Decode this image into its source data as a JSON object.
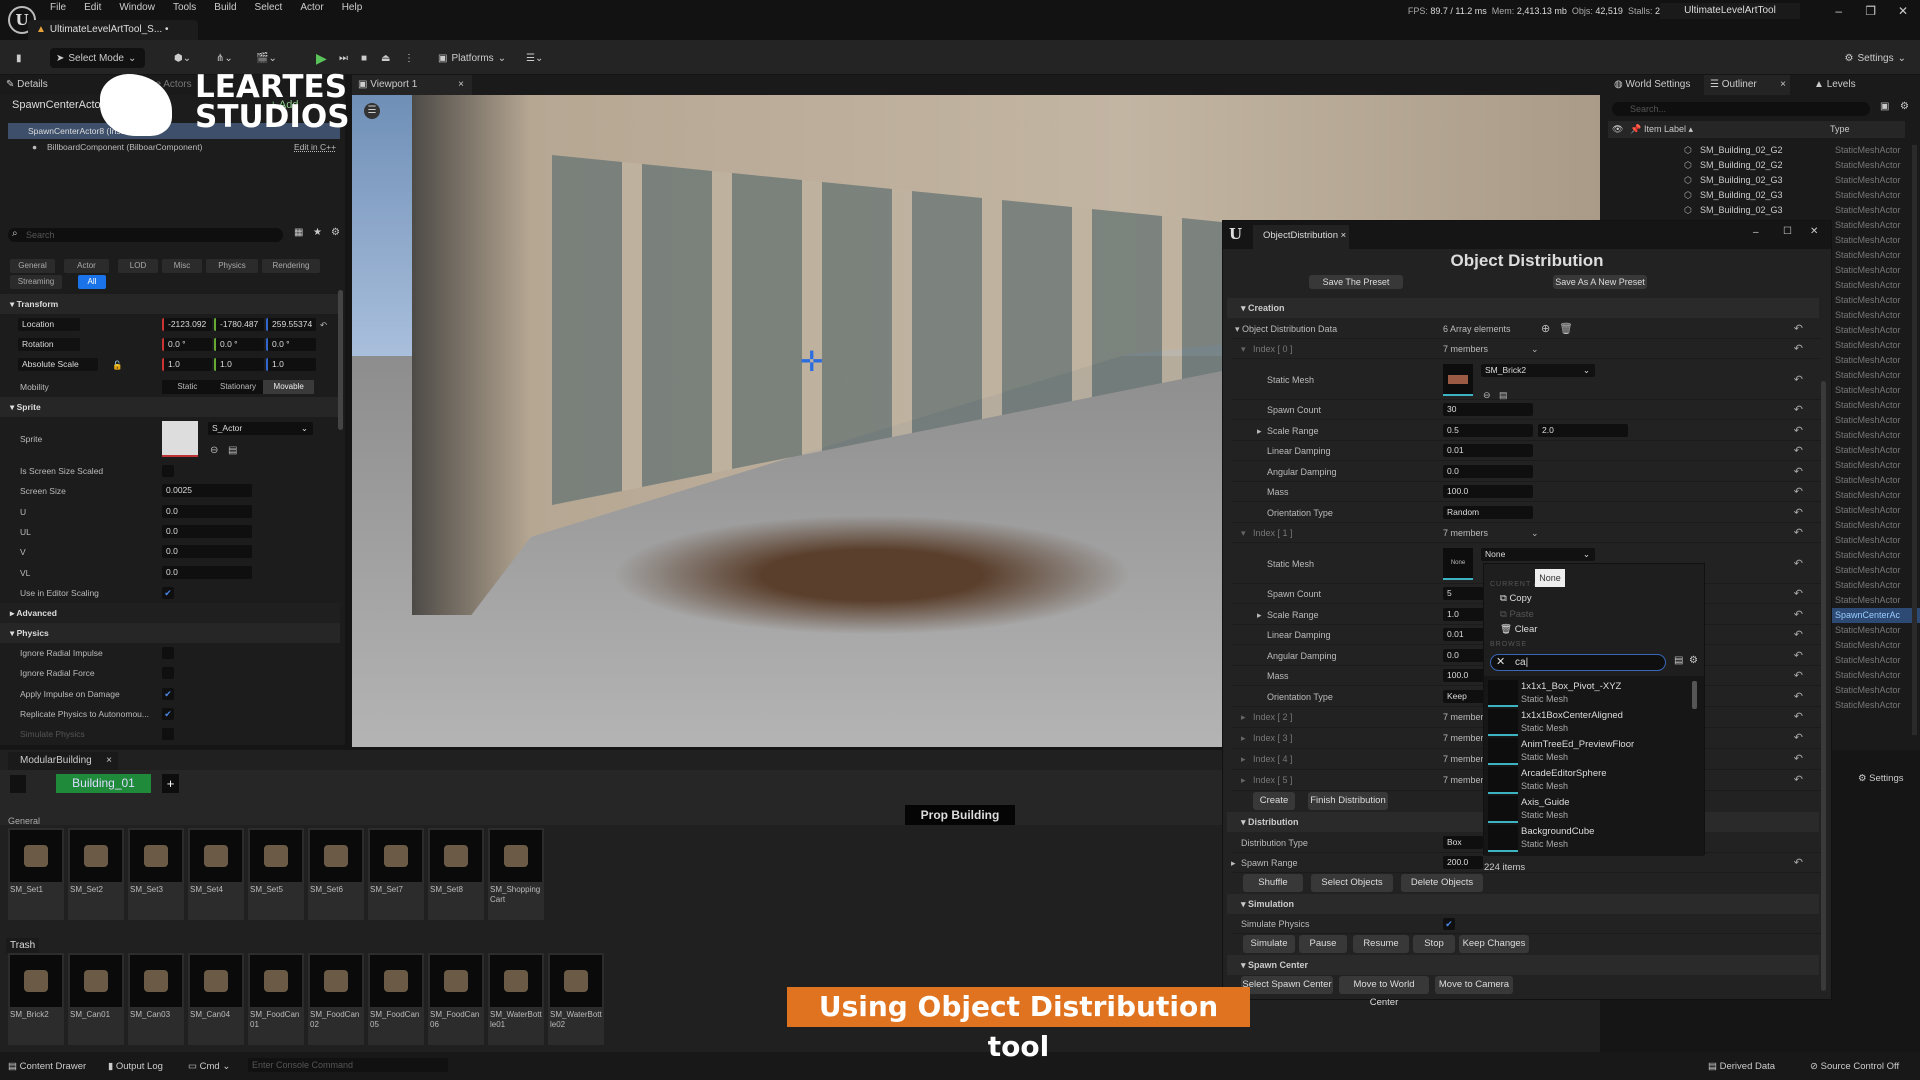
{
  "menu": [
    "File",
    "Edit",
    "Window",
    "Tools",
    "Build",
    "Select",
    "Actor",
    "Help"
  ],
  "doc_tab": "UltimateLevelArtTool_S...",
  "stats": {
    "fps_label": "FPS:",
    "fps": "89.7",
    "ms": "/ 11.2 ms",
    "mem_label": "Mem:",
    "mem": "2,413.13 mb",
    "objs_label": "Objs:",
    "objs": "42,519",
    "stalls_label": "Stalls:",
    "stalls": "2"
  },
  "app_title": "UltimateLevelArtTool",
  "toolbar": {
    "select_mode": "Select Mode",
    "platforms": "Platforms",
    "settings": "Settings"
  },
  "brand": {
    "line1": "LEARTES",
    "line2": "STUDIOS"
  },
  "details": {
    "tab": "Details",
    "tab2": "Place Actors",
    "actor": "SpawnCenterActor8",
    "add": "+ Add",
    "instance": "SpawnCenterActor8 (Instance)",
    "component": "BillboardComponent (BilboarComponent)",
    "edit_cpp": "Edit in C++",
    "search_placeholder": "Search",
    "categories": [
      "General",
      "Actor",
      "LOD",
      "Misc",
      "Physics",
      "Rendering",
      "Streaming",
      "All"
    ],
    "transform": "Transform",
    "location": {
      "label": "Location",
      "x": "-2123.092",
      "y": "-1780.487",
      "z": "259.55374"
    },
    "rotation": {
      "label": "Rotation",
      "x": "0.0 °",
      "y": "0.0 °",
      "z": "0.0 °"
    },
    "scale": {
      "label": "Absolute Scale",
      "x": "1.0",
      "y": "1.0",
      "z": "1.0"
    },
    "mobility": {
      "label": "Mobility",
      "options": [
        "Static",
        "Stationary",
        "Movable"
      ],
      "selected": "Movable"
    },
    "sprite_sec": "Sprite",
    "sprite_label": "Sprite",
    "sprite_value": "S_Actor",
    "sprite_rows": [
      {
        "label": "Is Screen Size Scaled",
        "type": "check",
        "checked": false
      },
      {
        "label": "Screen Size",
        "type": "field",
        "value": "0.0025"
      },
      {
        "label": "U",
        "type": "field",
        "value": "0.0"
      },
      {
        "label": "UL",
        "type": "field",
        "value": "0.0"
      },
      {
        "label": "V",
        "type": "field",
        "value": "0.0"
      },
      {
        "label": "VL",
        "type": "field",
        "value": "0.0"
      },
      {
        "label": "Use in Editor Scaling",
        "type": "check",
        "checked": true
      }
    ],
    "advanced": "Advanced",
    "physics": "Physics",
    "physics_rows": [
      {
        "label": "Ignore Radial Impulse",
        "checked": false
      },
      {
        "label": "Ignore Radial Force",
        "checked": false
      },
      {
        "label": "Apply Impulse on Damage",
        "checked": true
      },
      {
        "label": "Replicate Physics to Autonomou...",
        "checked": true
      },
      {
        "label": "Simulate Physics",
        "checked": false
      }
    ]
  },
  "viewport": {
    "tab": "Viewport 1"
  },
  "outliner": {
    "tabs": [
      "World Settings",
      "Outliner",
      "Levels"
    ],
    "search_placeholder": "Search...",
    "col_label": "Item Label",
    "col_type": "Type",
    "items": [
      "SM_Building_02_G2",
      "SM_Building_02_G2",
      "SM_Building_02_G3",
      "SM_Building_02_G3",
      "SM_Building_02_G3",
      "SM_Building_02_G3"
    ],
    "type": "StaticMeshActor",
    "selected_type": "SpawnCenterAc",
    "settings": "Settings"
  },
  "modular": {
    "tab": "ModularBuilding",
    "building": "Building_01",
    "add": "+",
    "prop_building": "Prop Building",
    "general_label": "General",
    "general": [
      "SM_Set1",
      "SM_Set2",
      "SM_Set3",
      "SM_Set4",
      "SM_Set5",
      "SM_Set6",
      "SM_Set7",
      "SM_Set8",
      "SM_ShoppingCart"
    ],
    "trash_label": "Trash",
    "trash": [
      "SM_Brick2",
      "SM_Can01",
      "SM_Can03",
      "SM_Can04",
      "SM_FoodCan01",
      "SM_FoodCan02",
      "SM_FoodCan05",
      "SM_FoodCan06",
      "SM_WaterBottle01",
      "SM_WaterBottle02"
    ]
  },
  "status": {
    "content_drawer": "Content Drawer",
    "output_log": "Output Log",
    "cmd": "Cmd",
    "console_placeholder": "Enter Console Command",
    "derived": "Derived Data",
    "source": "Source Control Off"
  },
  "caption": "Using Object Distribution tool",
  "od": {
    "tab": "ObjectDistribution",
    "title": "Object Distribution",
    "save": "Save The Preset",
    "save_new": "Save As A New Preset",
    "creation": "Creation",
    "data_label": "Object Distribution Data",
    "array": "6 Array elements",
    "index0": {
      "label": "Index [ 0 ]",
      "members": "7 members",
      "mesh": "SM_Brick2",
      "spawn_count": "30",
      "scale_min": "0.5",
      "scale_max": "2.0",
      "linear": "0.01",
      "angular": "0.0",
      "mass": "100.0",
      "orientation": "Random"
    },
    "index1": {
      "label": "Index [ 1 ]",
      "members": "7 members",
      "mesh": "None",
      "thumb": "None",
      "spawn_count": "5",
      "scale_min": "1.0",
      "linear": "0.01",
      "angular": "0.0",
      "mass": "100.0",
      "orientation": "Keep"
    },
    "fields": {
      "static_mesh": "Static Mesh",
      "spawn_count": "Spawn Count",
      "scale_range": "Scale Range",
      "linear": "Linear Damping",
      "angular": "Angular Damping",
      "mass": "Mass",
      "orientation": "Orientation Type"
    },
    "collapsed": [
      {
        "label": "Index [ 2 ]",
        "members": "7 members"
      },
      {
        "label": "Index [ 3 ]",
        "members": "7 members"
      },
      {
        "label": "Index [ 4 ]",
        "members": "7 members"
      },
      {
        "label": "Index [ 5 ]",
        "members": "7 members"
      }
    ],
    "create": "Create",
    "finish": "Finish Distribution",
    "distribution": "Distribution",
    "dist_type_label": "Distribution Type",
    "dist_type": "Box",
    "spawn_range_label": "Spawn Range",
    "spawn_range": "200.0",
    "shuffle": "Shuffle",
    "select_objects": "Select Objects",
    "delete_objects": "Delete Objects",
    "simulation": "Simulation",
    "sim_physics": "Simulate Physics",
    "sim_buttons": [
      "Simulate",
      "Pause",
      "Resume",
      "Stop",
      "Keep Changes"
    ],
    "spawn_center": "Spawn Center",
    "center_buttons": [
      "Select Spawn Center",
      "Move to World Center",
      "Move to Camera"
    ]
  },
  "popup": {
    "tooltip": "None",
    "current": "CURRENT ASSET",
    "copy": "Copy",
    "paste": "Paste",
    "clear": "Clear",
    "browse": "BROWSE",
    "search": "ca",
    "results": [
      {
        "name": "1x1x1_Box_Pivot_-XYZ",
        "type": "Static Mesh"
      },
      {
        "name": "1x1x1BoxCenterAligned",
        "type": "Static Mesh"
      },
      {
        "name": "AnimTreeEd_PreviewFloor",
        "type": "Static Mesh"
      },
      {
        "name": "ArcadeEditorSphere",
        "type": "Static Mesh"
      },
      {
        "name": "Axis_Guide",
        "type": "Static Mesh"
      },
      {
        "name": "BackgroundCube",
        "type": "Static Mesh"
      }
    ],
    "count": "224 items"
  },
  "colors": {
    "accent": "#1a73e8",
    "caption": "#e07320",
    "building_tab": "#1f8a3a",
    "thumb_underline": "#3cb3c0"
  }
}
